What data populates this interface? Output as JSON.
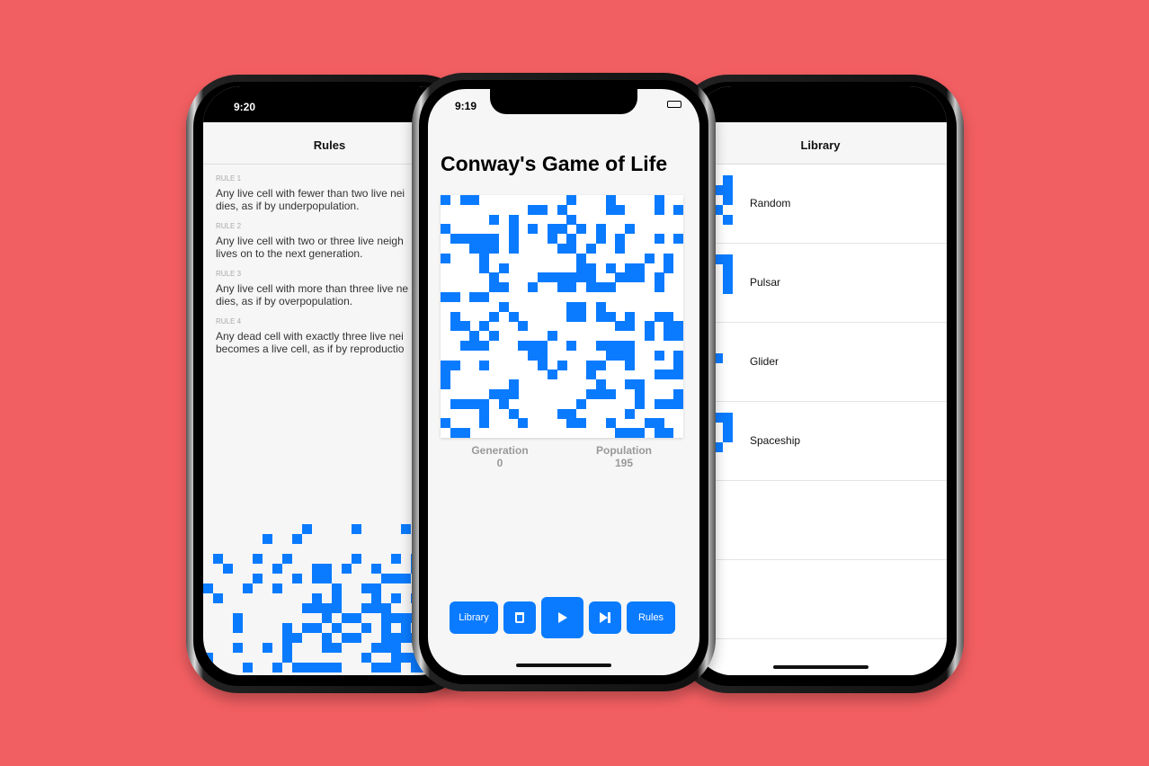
{
  "background_color": "#f25f62",
  "accent_color": "#0a7bff",
  "rules_screen": {
    "time": "9:20",
    "title": "Rules",
    "rules": [
      {
        "label": "RULE 1",
        "text": [
          "Any live cell with fewer than two live nei",
          "dies, as if by underpopulation."
        ]
      },
      {
        "label": "RULE 2",
        "text": [
          "Any live cell with two or three live neigh",
          "lives on to the next generation."
        ]
      },
      {
        "label": "RULE 3",
        "text": [
          "Any live cell with more than three live ne",
          "dies, as if by overpopulation."
        ]
      },
      {
        "label": "RULE 4",
        "text": [
          "Any dead cell with exactly three live nei",
          "becomes a live cell, as if by reproductio"
        ]
      }
    ]
  },
  "game_screen": {
    "time": "9:19",
    "title": "Conway's Game of Life",
    "generation_label": "Generation",
    "generation": "0",
    "population_label": "Population",
    "population": "195",
    "buttons": {
      "library": "Library",
      "clear_icon": "trash-icon",
      "play_icon": "play-icon",
      "step_icon": "step-forward-icon",
      "rules": "Rules"
    }
  },
  "library_screen": {
    "title": "Library",
    "items": [
      "Random",
      "Pulsar",
      "Glider",
      "Spaceship"
    ]
  }
}
